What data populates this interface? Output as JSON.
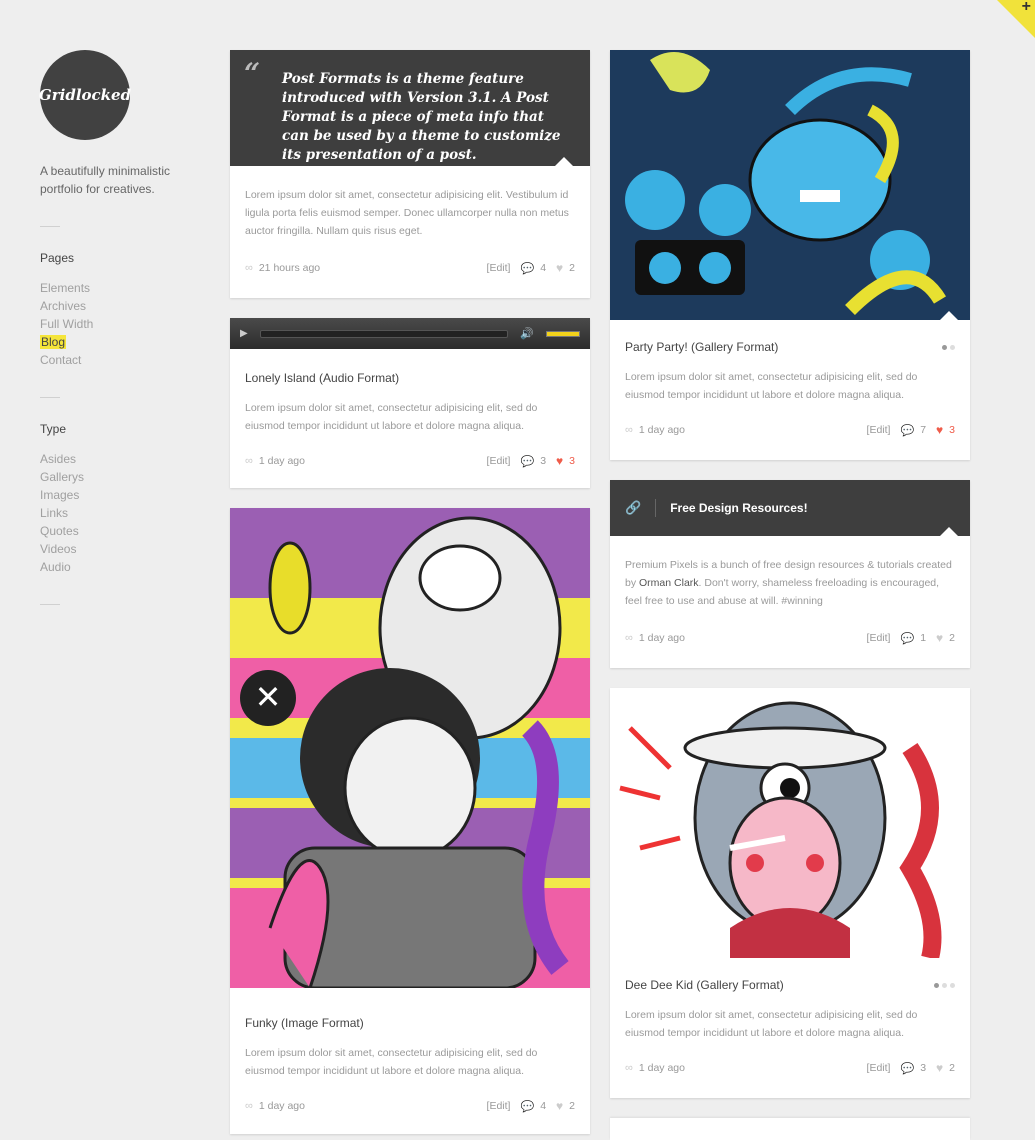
{
  "site": {
    "logo_text": "Gridlocked",
    "tagline": "A beautifully minimalistic portfolio for creatives."
  },
  "nav": {
    "pages_title": "Pages",
    "pages": [
      "Elements",
      "Archives",
      "Full Width",
      "Blog",
      "Contact"
    ],
    "active_page": "Blog",
    "type_title": "Type",
    "types": [
      "Asides",
      "Gallerys",
      "Images",
      "Links",
      "Quotes",
      "Videos",
      "Audio"
    ]
  },
  "colors": {
    "accent": "#f5e53a",
    "dark": "#3e3e3e",
    "heart_active": "#ef5c4a"
  },
  "posts": {
    "quote": {
      "quote_text": "Post Formats is a theme feature introduced with Version 3.1. A Post Format is a piece of meta info that can be used by a theme to customize its presentation of a post.",
      "excerpt": "Lorem ipsum dolor sit amet, consectetur adipisicing elit. Vestibulum id ligula porta felis euismod semper. Donec ullamcorper nulla non metus auctor fringilla. Nullam quis risus eget.",
      "time": "21 hours ago",
      "edit": "[Edit]",
      "comments": "4",
      "likes": "2"
    },
    "audio": {
      "title": "Lonely Island (Audio Format)",
      "excerpt": "Lorem ipsum dolor sit amet, consectetur adipisicing elit, sed do eiusmod tempor incididunt ut labore et dolore magna aliqua.",
      "time": "1 day ago",
      "edit": "[Edit]",
      "comments": "3",
      "likes": "3"
    },
    "funky": {
      "title": "Funky (Image Format)",
      "excerpt": "Lorem ipsum dolor sit amet, consectetur adipisicing elit, sed do eiusmod tempor incididunt ut labore et dolore magna aliqua.",
      "time": "1 day ago",
      "edit": "[Edit]",
      "comments": "4",
      "likes": "2"
    },
    "party": {
      "title": "Party Party! (Gallery Format)",
      "excerpt": "Lorem ipsum dolor sit amet, consectetur adipisicing elit, sed do eiusmod tempor incididunt ut labore et dolore magna aliqua.",
      "time": "1 day ago",
      "edit": "[Edit]",
      "comments": "7",
      "likes": "3"
    },
    "link": {
      "title": "Free Design Resources!",
      "excerpt_before": "Premium Pixels is a bunch of free design resources & tutorials created by",
      "excerpt_link": "Orman Clark",
      "excerpt_after": ". Don't worry, shameless freeloading is encouraged, feel free to use and abuse at will. #winning",
      "time": "1 day ago",
      "edit": "[Edit]",
      "comments": "1",
      "likes": "2"
    },
    "deedee": {
      "title": "Dee Dee Kid (Gallery Format)",
      "excerpt": "Lorem ipsum dolor sit amet, consectetur adipisicing elit, sed do eiusmod tempor incididunt ut labore et dolore magna aliqua.",
      "time": "1 day ago",
      "edit": "[Edit]",
      "comments": "3",
      "likes": "2"
    }
  }
}
